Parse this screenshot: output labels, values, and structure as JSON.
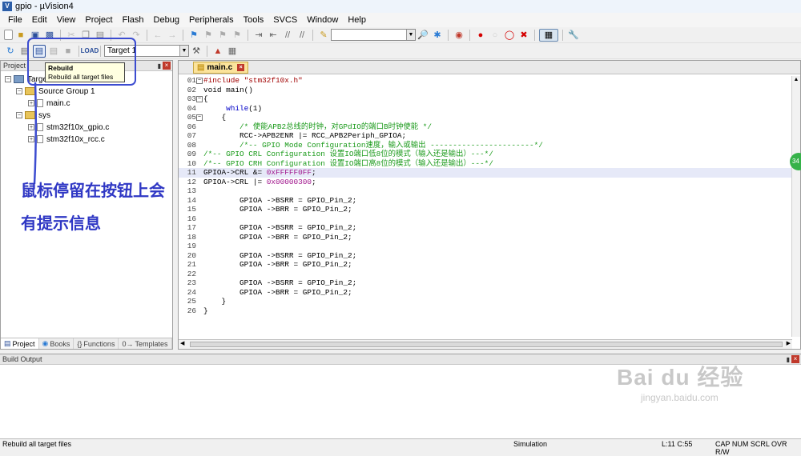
{
  "window": {
    "title": "gpio - µVision4",
    "app_icon": "V"
  },
  "menu": [
    "File",
    "Edit",
    "View",
    "Project",
    "Flash",
    "Debug",
    "Peripherals",
    "Tools",
    "SVCS",
    "Window",
    "Help"
  ],
  "toolbar": {
    "target_select": "Target 1"
  },
  "tooltip": {
    "title": "Rebuild",
    "desc": "Rebuild all target files"
  },
  "project_pane": {
    "title": "Project",
    "root": "Target 1",
    "group1": "Source Group 1",
    "file_main": "main.c",
    "group2": "sys",
    "file_gpio": "stm32f10x_gpio.c",
    "file_rcc": "stm32f10x_rcc.c",
    "tabs": [
      "Project",
      "Books",
      "Functions",
      "Templates"
    ]
  },
  "editor": {
    "tab": "main.c",
    "lines": [
      {
        "n": "01",
        "h": "<span class=\"st\">#include \"stm32f10x.h\"</span>"
      },
      {
        "n": "02",
        "h": "void main()"
      },
      {
        "n": "03",
        "h": "{"
      },
      {
        "n": "04",
        "h": "     <span class=\"kw\">while</span>(1)"
      },
      {
        "n": "05",
        "h": "    {"
      },
      {
        "n": "06",
        "h": "        <span class=\"cm\">/* 使能APB2总线的时钟，对GPdIO的端口B时钟使能 */</span>"
      },
      {
        "n": "07",
        "h": "        RCC->APB2ENR |= RCC_APB2Periph_GPIOA;"
      },
      {
        "n": "08",
        "h": "        <span class=\"cm\">/*-- GPIO Mode Configuration速度，输入或输出 -----------------------*/</span>"
      },
      {
        "n": "09",
        "h": "<span class=\"cm\">/*-- GPIO CRL Configuration 设置IO端口低8位的模式（输入还是输出）---*/</span>"
      },
      {
        "n": "10",
        "h": "<span class=\"cm\">/*-- GPIO CRH Configuration 设置IO端口高8位的模式（输入还是输出）---*/</span>"
      },
      {
        "n": "11",
        "h": "GPIOA->CRL &amp;= <span class=\"nm\">0xFFFFF0FF</span>;"
      },
      {
        "n": "12",
        "h": "GPIOA->CRL |= <span class=\"nm\">0x00000300</span>;"
      },
      {
        "n": "13",
        "h": ""
      },
      {
        "n": "14",
        "h": "        GPIOA ->BSRR = GPIO_Pin_2;"
      },
      {
        "n": "15",
        "h": "        GPIOA ->BRR = GPIO_Pin_2;"
      },
      {
        "n": "16",
        "h": ""
      },
      {
        "n": "17",
        "h": "        GPIOA ->BSRR = GPIO_Pin_2;"
      },
      {
        "n": "18",
        "h": "        GPIOA ->BRR = GPIO_Pin_2;"
      },
      {
        "n": "19",
        "h": ""
      },
      {
        "n": "20",
        "h": "        GPIOA ->BSRR = GPIO_Pin_2;"
      },
      {
        "n": "21",
        "h": "        GPIOA ->BRR = GPIO_Pin_2;"
      },
      {
        "n": "22",
        "h": ""
      },
      {
        "n": "23",
        "h": "        GPIOA ->BSRR = GPIO_Pin_2;"
      },
      {
        "n": "24",
        "h": "        GPIOA ->BRR = GPIO_Pin_2;"
      },
      {
        "n": "25",
        "h": "    }"
      },
      {
        "n": "26",
        "h": "}"
      }
    ],
    "current_line": "11"
  },
  "build_output": {
    "title": "Build Output"
  },
  "status": {
    "left": "Rebuild all target files",
    "mode": "Simulation",
    "pos": "L:11 C:55",
    "flags": "CAP  NUM  SCRL  OVR  R/W"
  },
  "annotation": {
    "line1": "鼠标停留在按钮上会",
    "line2": "有提示信息"
  },
  "badge": {
    "text": "34"
  },
  "watermark": {
    "brand": "Bai du 经验",
    "url": "jingyan.baidu.com"
  },
  "colors": {
    "annotation": "#2f37c4",
    "highlight": "#3c4cd0",
    "tab": "#fbe39b"
  }
}
